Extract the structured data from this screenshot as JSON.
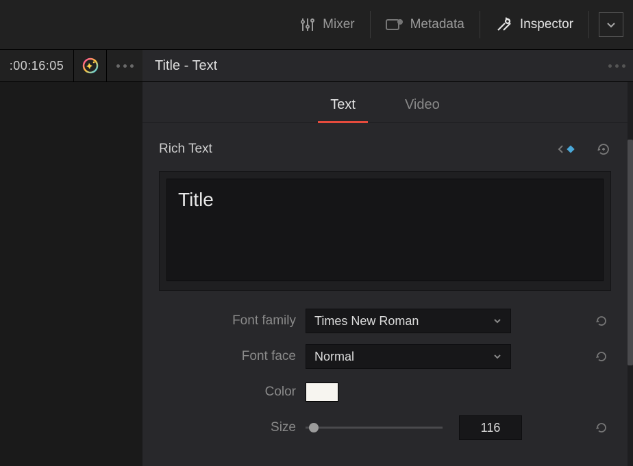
{
  "topbar": {
    "mixer": "Mixer",
    "metadata": "Metadata",
    "inspector": "Inspector"
  },
  "row2": {
    "timecode": ":00:16:05",
    "title": "Title - Text"
  },
  "tabs": {
    "text": "Text",
    "video": "Video"
  },
  "section": {
    "title": "Rich Text",
    "textarea_value": "Title"
  },
  "props": {
    "font_family_label": "Font family",
    "font_family_value": "Times New Roman",
    "font_face_label": "Font face",
    "font_face_value": "Normal",
    "color_label": "Color",
    "color_value": "#f7f5f0",
    "size_label": "Size",
    "size_value": "116"
  }
}
